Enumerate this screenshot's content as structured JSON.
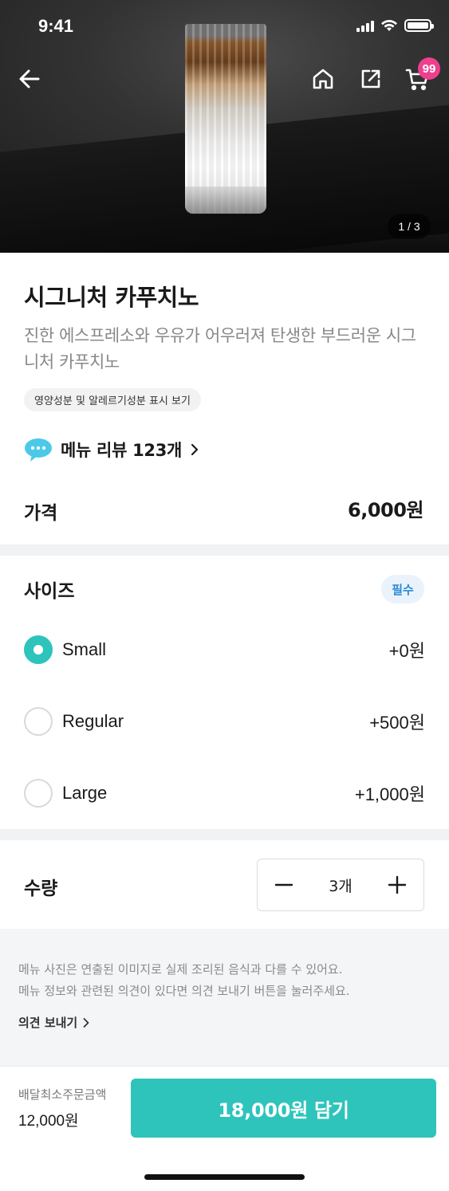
{
  "status_bar": {
    "time": "9:41"
  },
  "header": {
    "back_icon": "arrow-left-icon",
    "home_icon": "home-icon",
    "share_icon": "share-icon",
    "cart_icon": "cart-icon",
    "cart_badge": "99",
    "image_pager": "1 / 3"
  },
  "product": {
    "title": "시그니처 카푸치노",
    "description": "진한 에스프레소와 우유가 어우러져 탄생한 부드러운 시그니처 카푸치노",
    "nutrition_chip": "영양성분 및 알레르기성분 표시 보기",
    "review_link": "메뉴 리뷰 123개",
    "price_label": "가격",
    "price_value": "6,000원"
  },
  "size_section": {
    "title": "사이즈",
    "required_badge": "필수",
    "options": [
      {
        "name": "Small",
        "price": "+0원",
        "selected": true
      },
      {
        "name": "Regular",
        "price": "+500원",
        "selected": false
      },
      {
        "name": "Large",
        "price": "+1,000원",
        "selected": false
      }
    ]
  },
  "quantity_section": {
    "title": "수량",
    "value": "3개"
  },
  "notice": {
    "text_line1": "메뉴 사진은 연출된 이미지로 실제 조리된 음식과 다를 수 있어요.",
    "text_line2": "메뉴 정보와 관련된 의견이 있다면 의견 보내기 버튼을 눌러주세요.",
    "feedback_link": "의견 보내기"
  },
  "bottom_bar": {
    "min_order_label": "배달최소주문금액",
    "min_order_value": "12,000원",
    "add_button": "18,000원 담기"
  },
  "colors": {
    "accent": "#2ec4bb",
    "badge_pink": "#ee3f8f",
    "required_blue": "#2a8ad8"
  }
}
